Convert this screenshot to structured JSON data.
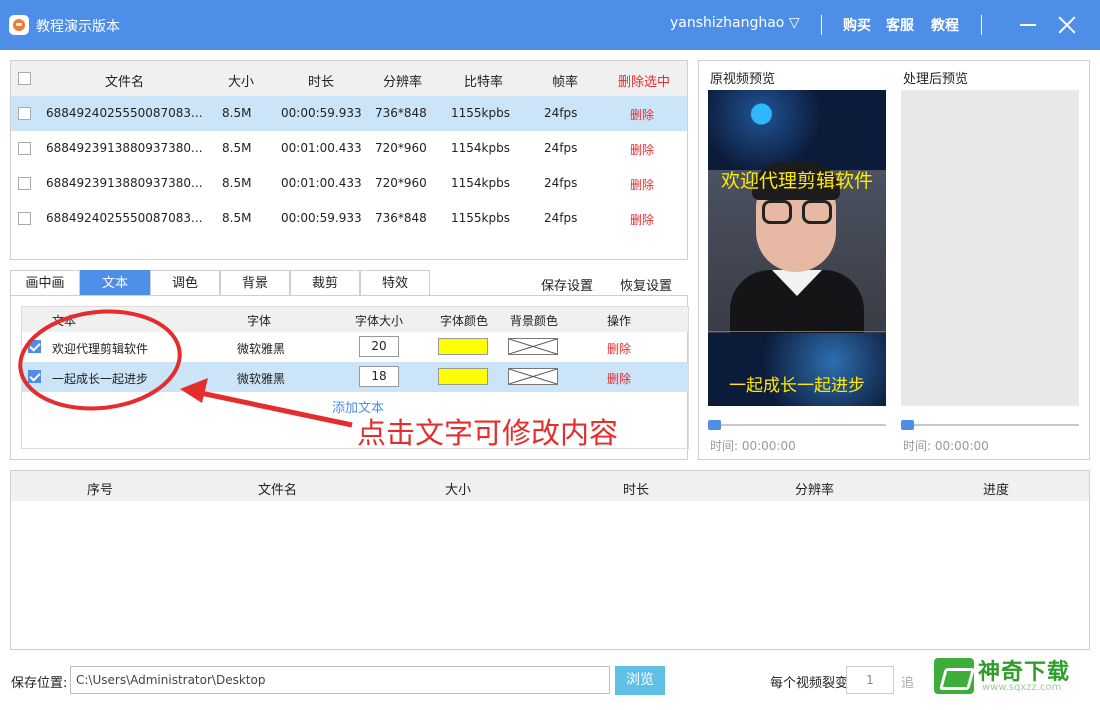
{
  "window": {
    "title": "教程演示版本",
    "user": "yanshizhanghao ▽",
    "links": [
      "购买",
      "客服",
      "教程"
    ]
  },
  "file_table": {
    "headers": [
      "文件名",
      "大小",
      "时长",
      "分辨率",
      "比特率",
      "帧率",
      "删除选中"
    ],
    "rows": [
      {
        "name": "6884924025550087083...",
        "size": "8.5M",
        "duration": "00:00:59.933",
        "resolution": "736*848",
        "bitrate": "1155kpbs",
        "fps": "24fps",
        "action": "删除"
      },
      {
        "name": "6884923913880937380...",
        "size": "8.5M",
        "duration": "00:01:00.433",
        "resolution": "720*960",
        "bitrate": "1154kpbs",
        "fps": "24fps",
        "action": "删除"
      },
      {
        "name": "6884923913880937380...",
        "size": "8.5M",
        "duration": "00:01:00.433",
        "resolution": "720*960",
        "bitrate": "1154kpbs",
        "fps": "24fps",
        "action": "删除"
      },
      {
        "name": "6884924025550087083...",
        "size": "8.5M",
        "duration": "00:00:59.933",
        "resolution": "736*848",
        "bitrate": "1155kpbs",
        "fps": "24fps",
        "action": "删除"
      }
    ]
  },
  "tabs": [
    "画中画",
    "文本",
    "调色",
    "背景",
    "裁剪",
    "特效"
  ],
  "tab_actions": {
    "save": "保存设置",
    "restore": "恢复设置"
  },
  "text_table": {
    "headers": [
      "文本",
      "字体",
      "字体大小",
      "字体颜色",
      "背景颜色",
      "操作"
    ],
    "rows": [
      {
        "text": "欢迎代理剪辑软件",
        "font": "微软雅黑",
        "size": "20",
        "action": "删除"
      },
      {
        "text": "一起成长一起进步",
        "font": "微软雅黑",
        "size": "18",
        "action": "删除"
      }
    ],
    "add_label": "添加文本",
    "font_color": "#ffff00"
  },
  "annotation": "点击文字可修改内容",
  "preview": {
    "original_label": "原视频预览",
    "processed_label": "处理后预览",
    "caption_top": "欢迎代理剪辑软件",
    "caption_bottom": "一起成长一起进步",
    "time_original": "时间:  00:00:00",
    "time_processed": "时间:  00:00:00"
  },
  "queue_table": {
    "headers": [
      "序号",
      "文件名",
      "大小",
      "时长",
      "分辨率",
      "进度"
    ]
  },
  "footer": {
    "save_label": "保存位置:",
    "save_path": "C:\\Users\\Administrator\\Desktop",
    "browse": "浏览",
    "split_label": "每个视频裂变",
    "split_value": "1",
    "split_unit": "追"
  },
  "watermark": {
    "title": "神奇下载",
    "url": "www.sqxzz.com"
  },
  "colors": {
    "accent": "#4d8fe8",
    "danger": "#e52d2d",
    "selected_row": "#cce4f7"
  }
}
